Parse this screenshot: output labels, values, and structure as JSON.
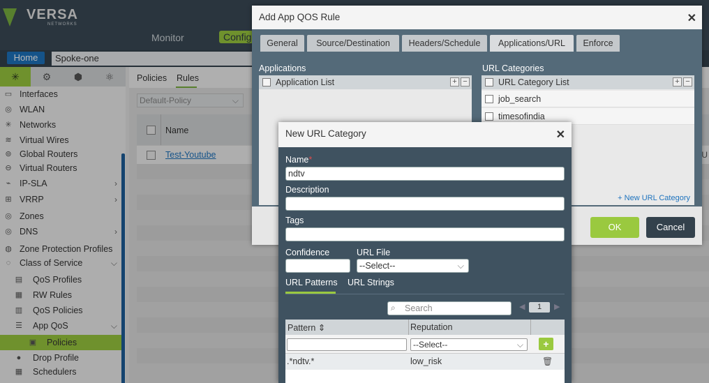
{
  "app": {
    "brand": "VERSA",
    "brand_sub": "NETWORKS",
    "nav": {
      "monitor": "Monitor",
      "config": "Config"
    },
    "home": "Home",
    "device": "Spoke-one"
  },
  "sidebar": {
    "items": [
      {
        "label": "Interfaces",
        "icon": "interfaces-icon"
      },
      {
        "label": "WLAN",
        "icon": "wlan-icon"
      },
      {
        "label": "Networks",
        "icon": "networks-icon"
      },
      {
        "label": "Virtual Wires",
        "icon": "virtual-wires-icon"
      },
      {
        "label": "Global Routers",
        "icon": "global-routers-icon"
      },
      {
        "label": "Virtual Routers",
        "icon": "virtual-routers-icon"
      },
      {
        "label": "IP-SLA",
        "icon": "ip-sla-icon"
      },
      {
        "label": "VRRP",
        "icon": "vrrp-icon"
      },
      {
        "label": "Zones",
        "icon": "zones-icon"
      },
      {
        "label": "DNS",
        "icon": "dns-icon"
      },
      {
        "label": "Zone Protection Profiles",
        "icon": "zone-protection-icon"
      },
      {
        "label": "Class of Service",
        "icon": "class-of-service-icon"
      },
      {
        "label": "QoS Profiles",
        "icon": "qos-profiles-icon"
      },
      {
        "label": "RW Rules",
        "icon": "rw-rules-icon"
      },
      {
        "label": "QoS Policies",
        "icon": "qos-policies-icon"
      },
      {
        "label": "App QoS",
        "icon": "app-qos-icon"
      },
      {
        "label": "Policies",
        "icon": "policies-icon"
      },
      {
        "label": "Drop Profile",
        "icon": "drop-profile-icon"
      },
      {
        "label": "Schedulers",
        "icon": "schedulers-icon"
      }
    ]
  },
  "main": {
    "tabs": {
      "policies": "Policies",
      "rules": "Rules"
    },
    "policy_select": "Default-Policy",
    "col_name": "Name",
    "rule_name": "Test-Youtube",
    "trail": "U"
  },
  "qos_modal": {
    "title": "Add App QOS Rule",
    "tabs": [
      "General",
      "Source/Destination",
      "Headers/Schedule",
      "Applications/URL",
      "Enforce"
    ],
    "applications_label": "Applications",
    "application_list": "Application List",
    "url_categories_label": "URL Categories",
    "url_category_list": "URL Category List",
    "url_categories": [
      "job_search",
      "timesofindia"
    ],
    "new_url_category": "+ New URL Category",
    "ok": "OK",
    "cancel": "Cancel"
  },
  "url_modal": {
    "title": "New URL Category",
    "name_label": "Name",
    "name_value": "ndtv",
    "description_label": "Description",
    "tags_label": "Tags",
    "confidence_label": "Confidence",
    "url_file_label": "URL File",
    "url_file_value": "--Select--",
    "tab_patterns": "URL Patterns",
    "tab_strings": "URL Strings",
    "search_placeholder": "Search",
    "page": "1",
    "col_pattern": "Pattern",
    "col_reputation": "Reputation",
    "reputation_select": "--Select--",
    "row_pattern": ".*ndtv.*",
    "row_reputation": "low_risk"
  }
}
